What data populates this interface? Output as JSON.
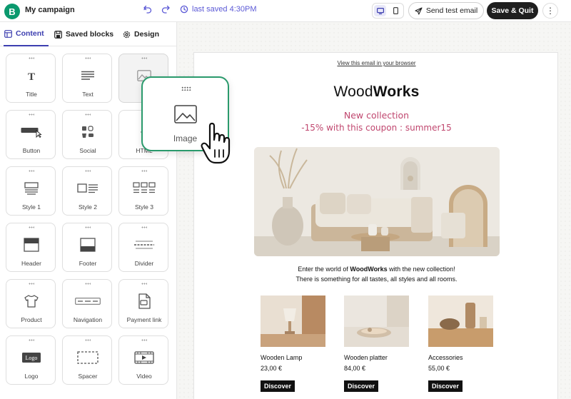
{
  "app": {
    "logo_letter": "B",
    "title": "My campaign",
    "saved_text": "last saved 4:30PM"
  },
  "toolbar": {
    "send_test_label": "Send test email",
    "save_quit_label": "Save & Quit"
  },
  "tabs": [
    {
      "label": "Content",
      "active": true
    },
    {
      "label": "Saved blocks",
      "active": false
    },
    {
      "label": "Design",
      "active": false
    }
  ],
  "blocks": [
    {
      "label": "Title",
      "icon": "title-icon"
    },
    {
      "label": "Text",
      "icon": "text-icon"
    },
    {
      "label": "Im",
      "icon": "image-icon"
    },
    {
      "label": "Button",
      "icon": "button-icon"
    },
    {
      "label": "Social",
      "icon": "social-icon"
    },
    {
      "label": "HTML",
      "icon": "html-icon"
    },
    {
      "label": "Style 1",
      "icon": "style1-icon"
    },
    {
      "label": "Style 2",
      "icon": "style2-icon"
    },
    {
      "label": "Style 3",
      "icon": "style3-icon"
    },
    {
      "label": "Header",
      "icon": "header-icon"
    },
    {
      "label": "Footer",
      "icon": "footer-icon"
    },
    {
      "label": "Divider",
      "icon": "divider-icon"
    },
    {
      "label": "Product",
      "icon": "product-icon"
    },
    {
      "label": "Navigation",
      "icon": "navigation-icon"
    },
    {
      "label": "Payment link",
      "icon": "payment-link-icon"
    },
    {
      "label": "Logo",
      "icon": "logo-icon",
      "icon_text": "Logo"
    },
    {
      "label": "Spacer",
      "icon": "spacer-icon"
    },
    {
      "label": "Video",
      "icon": "video-icon"
    }
  ],
  "drag_ghost": {
    "label": "Image",
    "icon": "image-icon"
  },
  "email": {
    "view_link": "View this email in your browser",
    "brand_light": "Wood",
    "brand_bold": "Works",
    "promo_line1": "New collection",
    "promo_line2": "-15% with this coupon : summer15",
    "intro_before": "Enter the world of ",
    "intro_bold": "WoodWorks",
    "intro_after": " with the new collection!",
    "intro_line2": "There is something for all tastes, all styles and all rooms.",
    "products": [
      {
        "name": "Wooden Lamp",
        "price": "23,00 €",
        "button": "Discover"
      },
      {
        "name": "Wooden platter",
        "price": "84,00 €",
        "button": "Discover"
      },
      {
        "name": "Accessories",
        "price": "55,00 €",
        "button": "Discover"
      }
    ]
  },
  "colors": {
    "accent": "#3d3fb0",
    "brand": "#0b996e",
    "promo": "#c0476f",
    "ghost_border": "#2a9a6c"
  }
}
